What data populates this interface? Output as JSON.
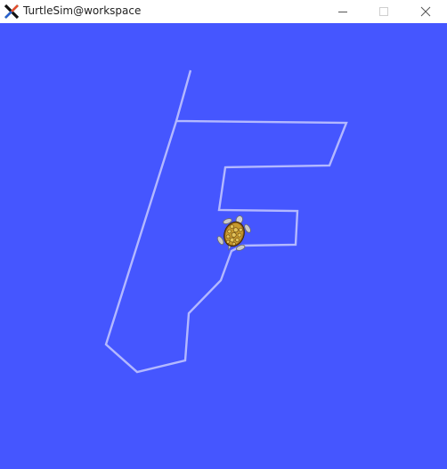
{
  "window": {
    "title": "TurtleSim@workspace",
    "icons": {
      "app": "x-logo-icon",
      "minimize": "minimize-icon",
      "maximize": "maximize-icon",
      "close": "close-icon"
    }
  },
  "canvas": {
    "background_color": "#4556ff",
    "pen_color": "#b3b8ff",
    "turtle_icon": "turtle-icon"
  }
}
